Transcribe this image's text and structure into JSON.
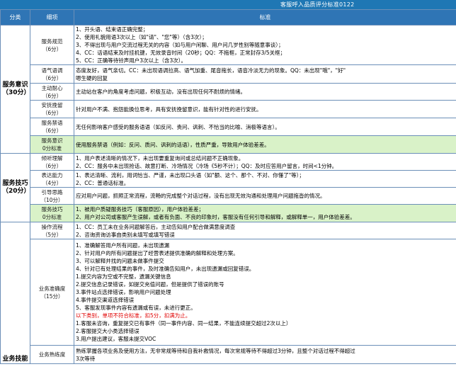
{
  "title": "客服呼入品质评分标准0122",
  "headers": {
    "category": "分类",
    "item": "细项",
    "standard": "标准"
  },
  "categories": {
    "service_awareness": {
      "name": "服务意识",
      "score": "（30分）"
    },
    "service_skill": {
      "name": "服务技巧",
      "score": "（20分）"
    },
    "business_skill": {
      "name": "业务技能"
    }
  },
  "rows": {
    "r1": {
      "item": "服务规范",
      "score": "（6分）",
      "lines": [
        "1、开头语、结束语正确完整；",
        "2、使用礼貌用语3次以上（如\"请\"、\"您\"等）（含3次）；",
        "3、不得出现与用户交流过程无关的内容（如与用户闲聊、用户问几岁性别等随意事谈）；",
        "4、CC：话语结束及时挂机键，无效录音时间（20秒；QQ：不拖框，正常封存3/5关框；",
        "5、CC：正确等待铃声用户3次以上（含3次）。"
      ]
    },
    "r2": {
      "item": "语气语调",
      "score": "（6分）",
      "lines": [
        "态度友好，语气亲切。CC：未出现语调拉高、语气加重、尾音拖长，语音冷淡无力的现象。QQ：未出现\"哦\"，\"好\"",
        "嗯生硬的回复"
      ]
    },
    "r3": {
      "item": "主动耐心",
      "score": "（6分）",
      "lines": [
        "主动站在客户的角度考虑问题，积极互动，没有出现任何不耐烦的情绪。"
      ]
    },
    "r4": {
      "item": "安抚挽留",
      "score": "（6分）",
      "lines": [
        "针对用户不满、抱怨能换位思考，具有安抚挽留意识，能有针对性的进行安抚。"
      ]
    },
    "r5": {
      "item": "服务禁语",
      "score": "（6分）",
      "lines": [
        "无任何影响客户感受的服务语语（如反问、责问、讽刺、不恰当的比喻、消极等语言）。"
      ]
    },
    "r6": {
      "item": "服务意识",
      "score": "0分标准",
      "lines": [
        "使用服务禁语（例如：反问、质问、讽刺的话语），性质严重，导致用户体验差差。"
      ]
    },
    "r7": {
      "item": "倾听理解",
      "score": "（6分）",
      "lines": [
        "1、用户表述清晰的情况下，未出现要重复询问或总结问题不正确现象。",
        "2、CC：服务中未出现抢话、故意打断、冷场情况（冷场《5秒不计）；QQ：及时应答用户留言，时间<1分钟。"
      ]
    },
    "r8": {
      "item": "表达能力",
      "score": "（4分）",
      "lines": [
        "1、表达清晰、流利，用词恰当、严谨，未出现口头语（如\"额、这个、那个、不对、你懂了\"等）；",
        "2、CC：普通话标准。"
      ]
    },
    "r9": {
      "item": "引导思路",
      "score": "（10分）",
      "lines": [
        "应对用户问题，抓照正常流程，流畅的完成整个对话过程，没有出现无效沟通和处理用户问题拖沓的情况。"
      ]
    },
    "r10": {
      "item": "服务技巧",
      "score": "0分标准",
      "lines": [
        "1、被用户质疑服务技巧（客服原因），用户体验差差；",
        "2、用户对公司或客服产生误解，或者有负面、不良的印象时，客服没有任何引导和解释，或解释单一，用户体验差差。"
      ]
    },
    "r11": {
      "item": "操作流程",
      "score": "（5分）",
      "lines": [
        "1、CC：员工未在业务问题解答后，主动告知用户配合做满意度调查",
        "2、咨询资询访事由类别未填写或填写错误"
      ]
    },
    "r12": {
      "item": "业务准确度",
      "score": "（15分）",
      "lines": [
        "1、准确解答用户所有问题，未出现遗漏",
        "2、针对用户的所有问题提出了经营表述提供准确的解释和处理方案。",
        "3、可以解释并找的问题未做事件提交",
        "4、针对已有处理结果的事件，及时准确告知用户，未出现遗漏或回复错误。",
        "1.提交内容为空或不完整，遗漏关键信息",
        "2.提交信息记录错误，如提交充值问题，但是提供了错误的账号",
        "3.事件站点选择错误，影响用户问题处理",
        "4.事件提交渠道选择错误",
        "5、客服发现事件内容有遗漏或有误，未进行更正。",
        "以下类别，单项不符合标准，扣5分，扣满为止。",
        "1.客服未咨询，重复提交已有事件（同一事件内容、同一结果，不能连续提交超过2次以上）",
        "2.客服提交大小类选择错误",
        "3.用户提出建议，客服未提交VOC"
      ]
    },
    "r13": {
      "item": "业务熟练度",
      "score": "",
      "lines": [
        "熟练掌握各项业务及使用方法，无非常规等待和自我补救情况，每次常规等待不得超过3分钟，且整个对话过程不得超过",
        "3次等待"
      ]
    }
  }
}
